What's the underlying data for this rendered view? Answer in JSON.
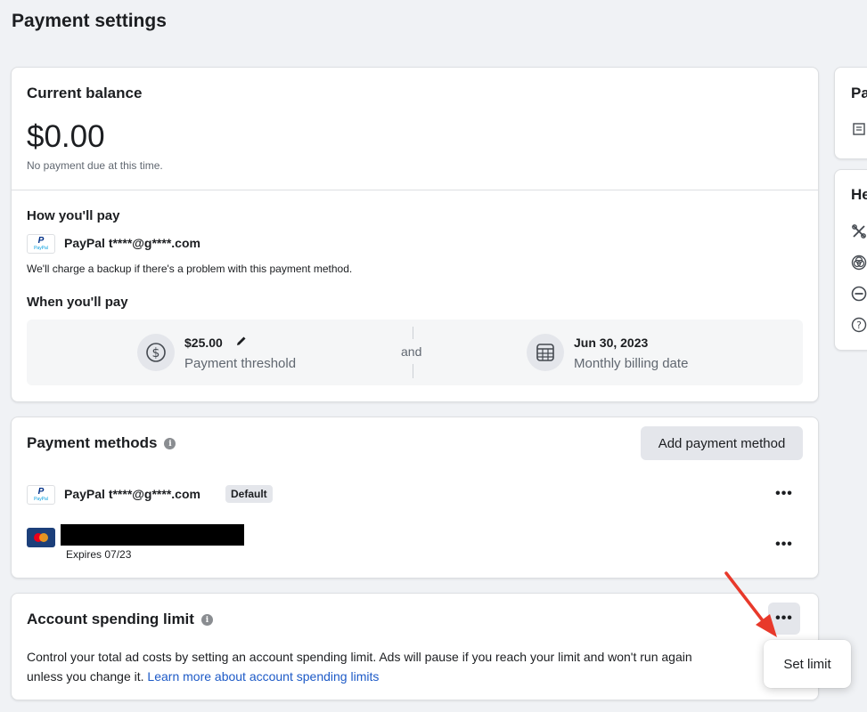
{
  "page": {
    "title": "Payment settings"
  },
  "balance": {
    "heading": "Current balance",
    "amount": "$0.00",
    "note": "No payment due at this time."
  },
  "how_pay": {
    "heading": "How you'll pay",
    "method": "PayPal t****@g****.com",
    "note": "We'll charge a backup if there's a problem with this payment method."
  },
  "when_pay": {
    "heading": "When you'll pay",
    "threshold_amount": "$25.00",
    "threshold_label": "Payment threshold",
    "connector": "and",
    "billing_date": "Jun 30, 2023",
    "billing_label": "Monthly billing date"
  },
  "methods": {
    "heading": "Payment methods",
    "add_button": "Add payment method",
    "items": [
      {
        "label": "PayPal t****@g****.com",
        "badge": "Default"
      },
      {
        "label": "",
        "expires": "Expires 07/23"
      }
    ]
  },
  "limit": {
    "heading": "Account spending limit",
    "desc_line1": "Control your total ad costs by setting an account spending limit. Ads will pause if you reach your limit and won't run again",
    "desc_line2": "unless you change it.",
    "learn_more": "Learn more about account spending limits",
    "popup": "Set limit"
  },
  "side": {
    "top_title": "Pa",
    "help_title": "He"
  },
  "icons": {
    "edit": "pencil-icon",
    "dollar": "dollar-icon",
    "calendar": "calendar-icon",
    "info": "info-icon",
    "more": "more-icon"
  },
  "colors": {
    "link": "#1d5ac7",
    "arrow": "#e8392b",
    "background": "#f0f2f5"
  }
}
